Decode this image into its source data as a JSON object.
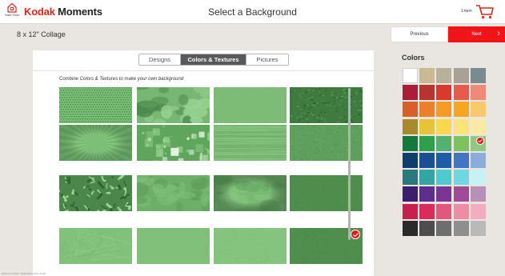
{
  "header": {
    "home_label": "Start Over",
    "brand_kodak": "Kodak",
    "brand_moments": "Moments",
    "title": "Select a Background",
    "cart_count": "1 item",
    "home_icon": "house-icon",
    "cart_icon": "shopping-cart-icon"
  },
  "subheader": {
    "product_name": "8 x 12\" Collage",
    "previous_label": "Previous",
    "next_label": "Next"
  },
  "tabs": [
    {
      "label": "Designs",
      "active": false
    },
    {
      "label": "Colors & Textures",
      "active": true
    },
    {
      "label": "Pictures",
      "active": false
    }
  ],
  "hint": "Combine Colors & Textures to make your own background",
  "textures": {
    "rows": 4,
    "columns": 4,
    "selected_index": 15,
    "items": [
      "houndstooth",
      "camouflage",
      "diagonal-stripes",
      "dark-grunge",
      "sunburst",
      "light-squares",
      "brushed-lines",
      "fine-grunge",
      "foliage",
      "mottled",
      "mottled-vignette",
      "dark-solid",
      "crumpled-paper",
      "linen",
      "fine-noise",
      "dark-noise"
    ]
  },
  "colors_panel": {
    "title": "Colors",
    "swatches": [
      "#ffffff",
      "#c9b994",
      "#b7b19c",
      "#aaa196",
      "#7b8a8e",
      "#a71d3a",
      "#b8342f",
      "#d83a30",
      "#e85a4e",
      "#ef8a78",
      "#d65f2a",
      "#ee7f2a",
      "#f39a27",
      "#f5a623",
      "#f9c86b",
      "#a68a2c",
      "#e9c23a",
      "#f9d84a",
      "#fbe47a",
      "#fbe9a7",
      "#15783c",
      "#2ea04a",
      "#53b36e",
      "#7cc25e",
      "#8fca84",
      "#0f3d6e",
      "#1b4f94",
      "#1d5ea9",
      "#4276c3",
      "#8aaed9",
      "#2a7a7d",
      "#34a5a5",
      "#4fcbd0",
      "#6fd7e2",
      "#c7f2f4",
      "#3b1f6e",
      "#5d2e8c",
      "#7b3594",
      "#a24a98",
      "#b990b5",
      "#c81f4e",
      "#dc2a5b",
      "#e4577c",
      "#ee8ca4",
      "#f1aec0",
      "#2a2a2a",
      "#4d4d4d",
      "#6e6e6e",
      "#8e8e8e",
      "#b9b9b9"
    ],
    "selected_index": 24
  },
  "footer": {
    "version": "APPv.3.0.27310 · Build 2017-09-11 12:00"
  }
}
